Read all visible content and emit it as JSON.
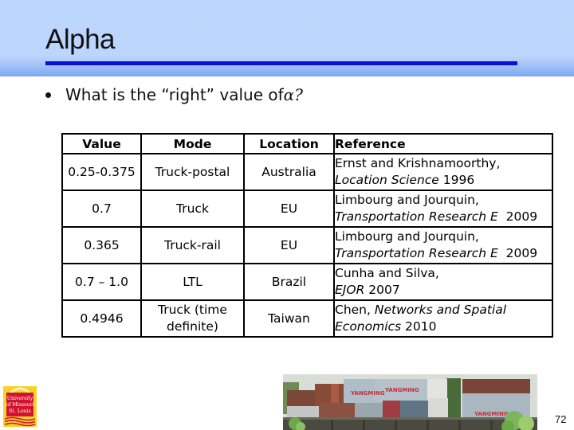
{
  "slide": {
    "title": "Alpha",
    "bullet": {
      "text": "What is the “right” value of",
      "symbol": "α",
      "suffix": "?"
    },
    "page_number": "72",
    "colors": {
      "header_top": "#bcd5fc",
      "header_bottom": "#7aa6f2",
      "title_rule": "#0a0fd6"
    }
  },
  "table": {
    "headers": [
      "Value",
      "Mode",
      "Location",
      "Reference"
    ],
    "rows": [
      {
        "value": "0.25-0.375",
        "mode": "Truck-postal",
        "location": "Australia",
        "ref_authors": "Ernst and Krishnamoorthy,",
        "ref_journal": "Location Science",
        "ref_year": " 1996"
      },
      {
        "value": "0.7",
        "mode": "Truck",
        "location": "EU",
        "ref_authors": "Limbourg and Jourquin,",
        "ref_journal": "Transportation Research E",
        "ref_year": "  2009"
      },
      {
        "value": "0.365",
        "mode": "Truck-rail",
        "location": "EU",
        "ref_authors": "Limbourg and Jourquin,",
        "ref_journal": "Transportation Research E",
        "ref_year": "  2009"
      },
      {
        "value": "0.7 – 1.0",
        "mode": "LTL",
        "location": "Brazil",
        "ref_authors": "Cunha and Silva,",
        "ref_journal": "EJOR",
        "ref_year": " 2007"
      },
      {
        "value": "0.4946",
        "mode": "Truck (time definite)",
        "location": "Taiwan",
        "ref_authors": "Chen, ",
        "ref_journal": "Networks and Spatial Economics",
        "ref_year": " 2010"
      }
    ]
  },
  "images": {
    "logo": {
      "label_lines": [
        "University",
        "of Missouri",
        "St. Louis"
      ],
      "icon": "university-logo"
    },
    "photo": {
      "description": "container freight train",
      "container_text": "YANGMING"
    }
  }
}
